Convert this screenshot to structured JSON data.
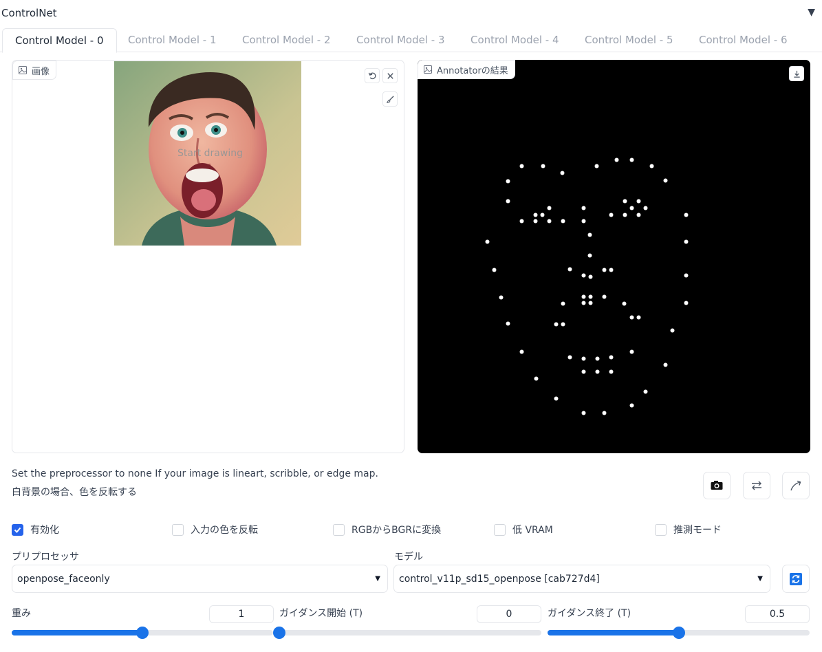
{
  "header": {
    "title": "ControlNet"
  },
  "tabs": [
    {
      "label": "Control Model - 0",
      "active": true
    },
    {
      "label": "Control Model - 1",
      "active": false
    },
    {
      "label": "Control Model - 2",
      "active": false
    },
    {
      "label": "Control Model - 3",
      "active": false
    },
    {
      "label": "Control Model - 4",
      "active": false
    },
    {
      "label": "Control Model - 5",
      "active": false
    },
    {
      "label": "Control Model - 6",
      "active": false
    }
  ],
  "image_panel": {
    "label": "画像",
    "canvas_hint": "Start drawing",
    "photo_icon": "image-icon",
    "actions": [
      "undo-icon",
      "close-icon",
      "brush-icon"
    ]
  },
  "annotator_panel": {
    "label": "Annotatorの結果",
    "actions": [
      "download-icon"
    ]
  },
  "hints": {
    "line1": "Set the preprocessor to none If your image is lineart, scribble, or edge map.",
    "line2": "白背景の場合、色を反転する"
  },
  "tools": [
    "camera-icon",
    "swap-icon",
    "send-icon"
  ],
  "options": [
    {
      "label": "有効化",
      "checked": true
    },
    {
      "label": "入力の色を反転",
      "checked": false
    },
    {
      "label": "RGBからBGRに変換",
      "checked": false
    },
    {
      "label": "低 VRAM",
      "checked": false
    },
    {
      "label": "推測モード",
      "checked": false
    }
  ],
  "preprocessor": {
    "label": "プリプロセッサ",
    "value": "openpose_faceonly"
  },
  "model": {
    "label": "モデル",
    "value": "control_v11p_sd15_openpose [cab727d4]"
  },
  "sliders": [
    {
      "label": "重み",
      "value": "1",
      "fraction": 0.5
    },
    {
      "label": "ガイダンス開始 (T)",
      "value": "0",
      "fraction": 0.0
    },
    {
      "label": "ガイダンス終了 (T)",
      "value": "0.5",
      "fraction": 0.5
    }
  ],
  "colors": {
    "accent": "#1a73e8",
    "checkbox": "#2563eb",
    "annotator_bg": "#000000"
  }
}
